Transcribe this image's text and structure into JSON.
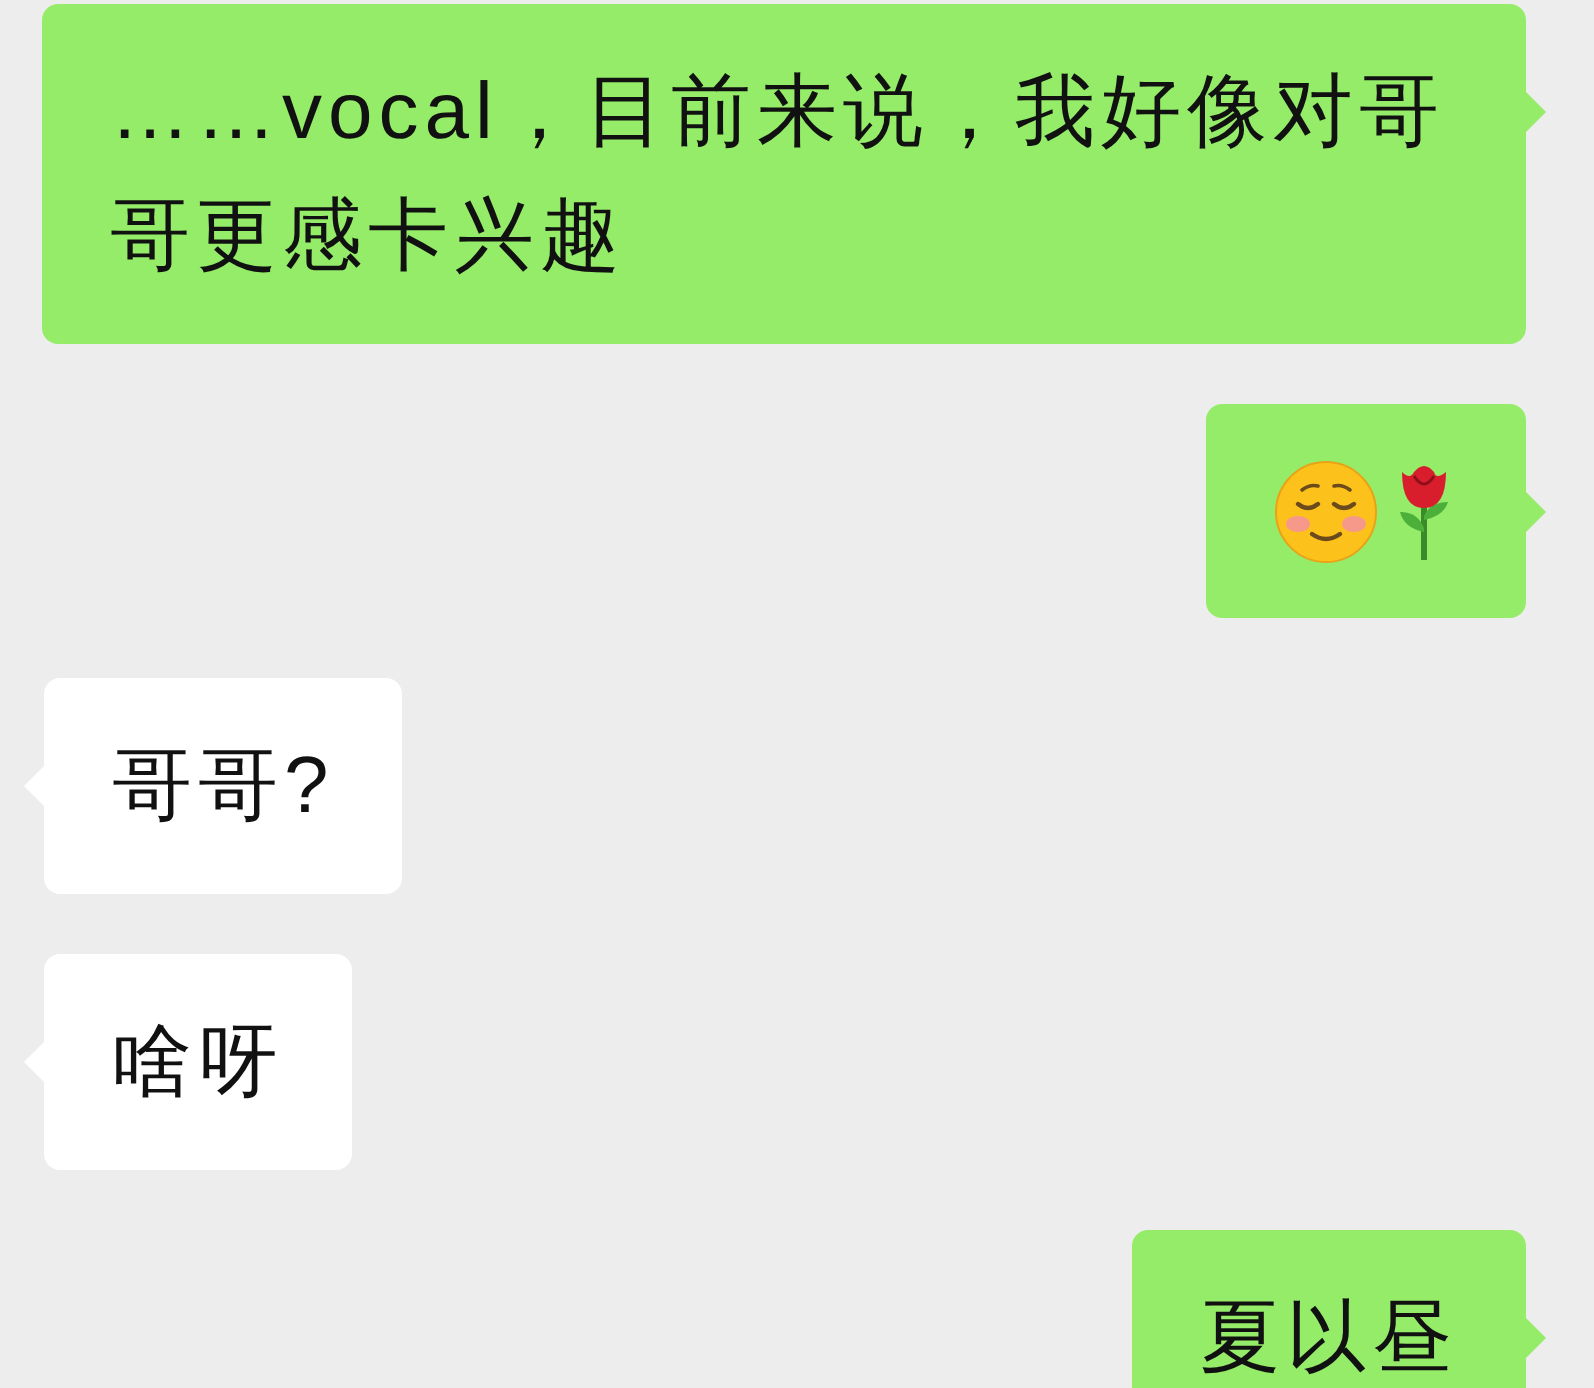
{
  "messages": [
    {
      "kind": "sent",
      "text": "……vocal，目前来说，我好像对哥哥更感卡兴趣"
    },
    {
      "kind": "sent",
      "emojis": [
        {
          "kind": "relieved-face"
        },
        {
          "kind": "rose"
        }
      ]
    },
    {
      "kind": "received",
      "text": "哥哥?"
    },
    {
      "kind": "received",
      "text": "啥呀"
    },
    {
      "kind": "sent",
      "text": "夏以昼"
    }
  ]
}
